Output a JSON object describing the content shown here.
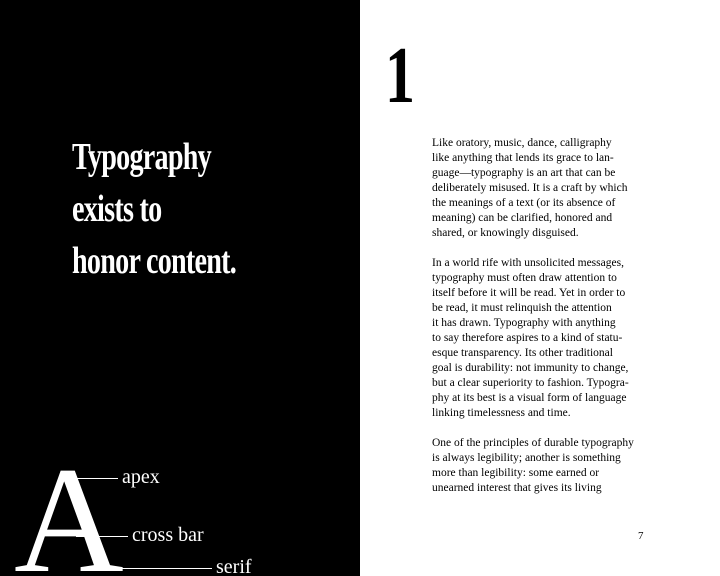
{
  "left_page": {
    "headline_lines": [
      "Typography",
      "exists to",
      "honor content."
    ],
    "diagram": {
      "letter": "A",
      "labels": {
        "apex": "apex",
        "cross_bar": "cross bar",
        "serif": "serif"
      }
    }
  },
  "right_page": {
    "chapter_number": "1",
    "paragraphs": [
      {
        "lines": [
          "Like oratory, music, dance, calligraphy",
          "like anything that lends its grace to lan-",
          "guage—typography is an art that can be",
          "deliberately misused. It is a craft by which",
          "the meanings of a text (or its absence of",
          "meaning) can be clarified, honored and",
          "shared, or knowingly disguised."
        ]
      },
      {
        "lines": [
          "In a world rife with unsolicited messages,",
          "typography must often draw attention to",
          "itself before it will be read. Yet in order to",
          "be read, it must relinquish the attention",
          "it has drawn. Typography with anything",
          "to say therefore aspires to a kind of statu-",
          "esque transparency. Its other traditional",
          "goal is durability: not immunity to change,",
          "but a clear superiority to fashion. Typogra-",
          "phy at its best is a visual form of language",
          "linking timelessness and time."
        ]
      },
      {
        "lines": [
          "One of the principles of durable typography",
          "is always legibility; another is something",
          "more than legibility: some earned or",
          "unearned interest that gives its living"
        ]
      }
    ],
    "page_number": "7"
  }
}
